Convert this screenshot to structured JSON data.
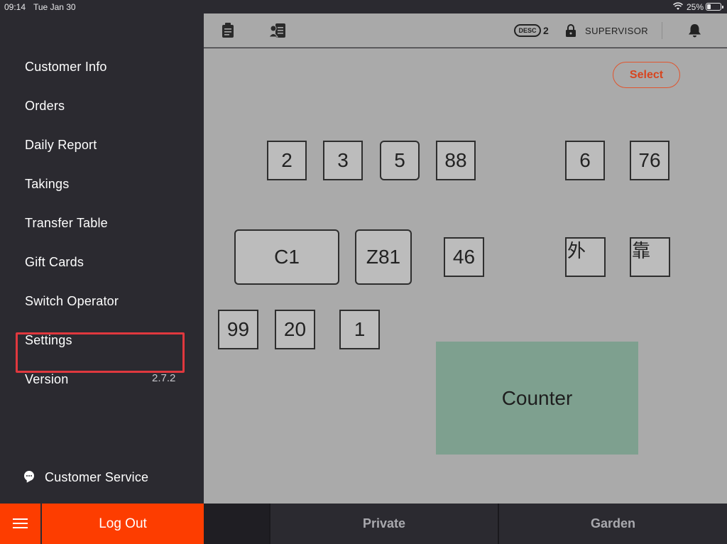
{
  "status_bar": {
    "time": "09:14",
    "date": "Tue Jan 30",
    "battery_percent": "25%"
  },
  "sidebar": {
    "items": [
      {
        "label": "Customer Info"
      },
      {
        "label": "Orders"
      },
      {
        "label": "Daily Report"
      },
      {
        "label": "Takings"
      },
      {
        "label": "Transfer Table"
      },
      {
        "label": "Gift Cards"
      },
      {
        "label": "Switch Operator"
      },
      {
        "label": "Settings"
      },
      {
        "label": "Version"
      }
    ],
    "version_value": "2.7.2",
    "customer_service_label": "Customer Service",
    "logout_label": "Log Out",
    "highlighted_item": "Settings",
    "highlight_color": "#e0383e"
  },
  "toolbar": {
    "desc_badge": "DESC",
    "desc_count": "2",
    "role": "SUPERVISOR"
  },
  "floor": {
    "select_label": "Select",
    "tables": [
      {
        "label": "2"
      },
      {
        "label": "3"
      },
      {
        "label": "5"
      },
      {
        "label": "88"
      },
      {
        "label": "6"
      },
      {
        "label": "76"
      },
      {
        "label": "C1"
      },
      {
        "label": "Z81"
      },
      {
        "label": "46"
      },
      {
        "label": "外"
      },
      {
        "label": "靠"
      },
      {
        "label": "99"
      },
      {
        "label": "20"
      },
      {
        "label": "1"
      }
    ],
    "counter_label": "Counter",
    "counter_color": "#7ea08f"
  },
  "tabs": [
    {
      "label": ""
    },
    {
      "label": "Private"
    },
    {
      "label": "Garden"
    }
  ],
  "accent_color": "#fd3d00"
}
